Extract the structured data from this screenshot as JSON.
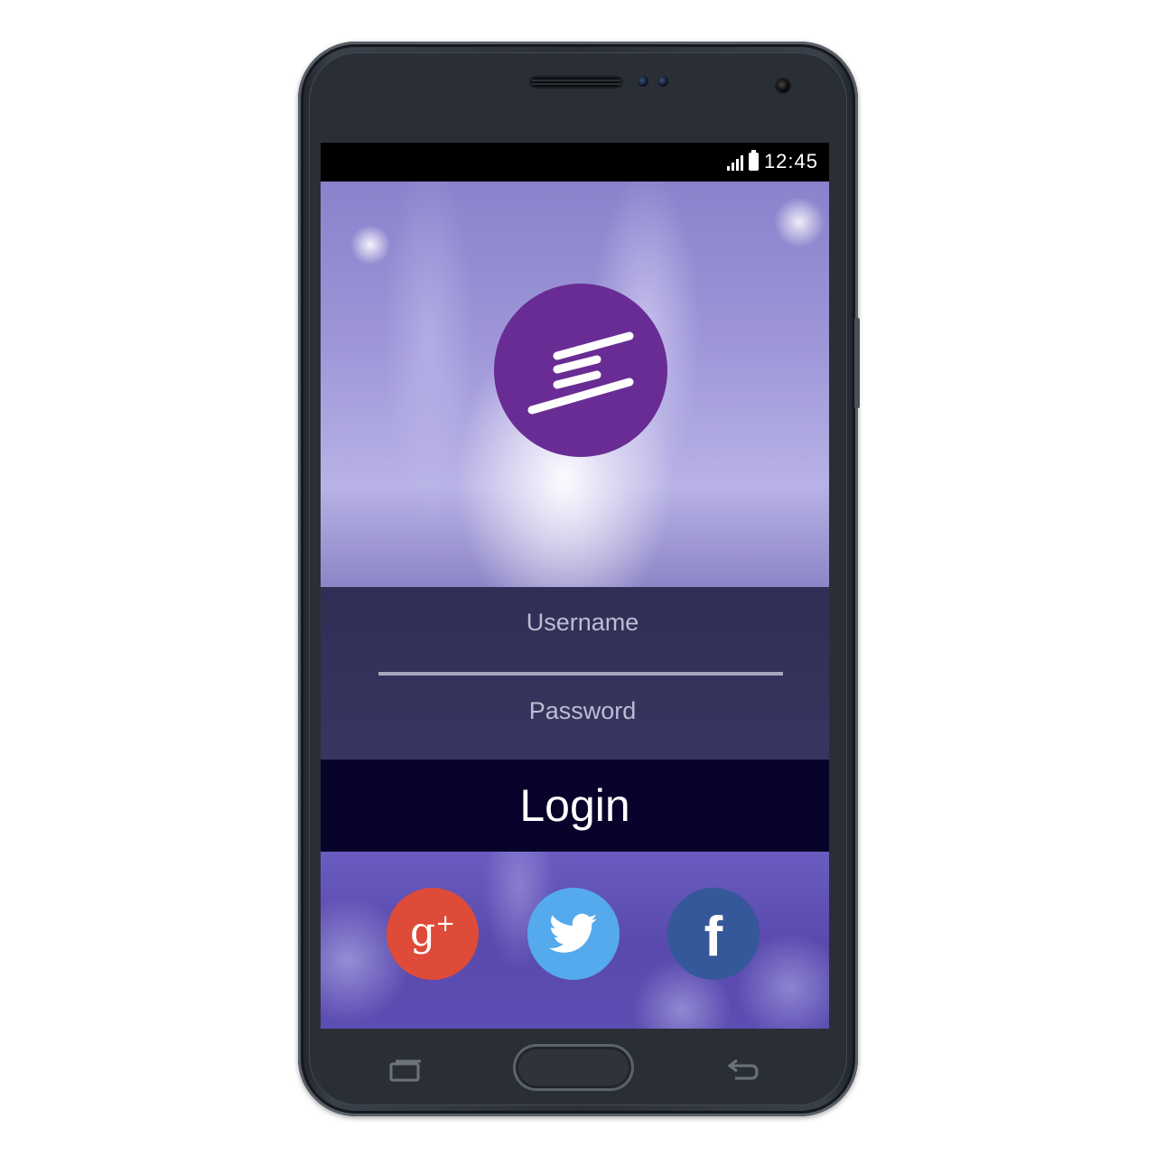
{
  "status_bar": {
    "time": "12:45",
    "signal_icon": "signal-bars-icon",
    "battery_icon": "battery-icon"
  },
  "app": {
    "logo_icon": "app-logo-icon",
    "logo_color": "#692c94",
    "username": {
      "placeholder": "Username",
      "value": ""
    },
    "password": {
      "placeholder": "Password",
      "value": ""
    },
    "login_label": "Login",
    "login_bg": "#07032a"
  },
  "social": {
    "google_plus": {
      "icon": "google-plus-icon",
      "glyph": "g",
      "sup": "+",
      "color": "#de4b39"
    },
    "twitter": {
      "icon": "twitter-bird-icon",
      "color": "#54aaec"
    },
    "facebook": {
      "icon": "facebook-icon",
      "glyph": "f",
      "color": "#345899"
    }
  },
  "device": {
    "recent_apps_icon": "recent-apps-icon",
    "home_button": "home-button",
    "back_icon": "back-icon"
  }
}
